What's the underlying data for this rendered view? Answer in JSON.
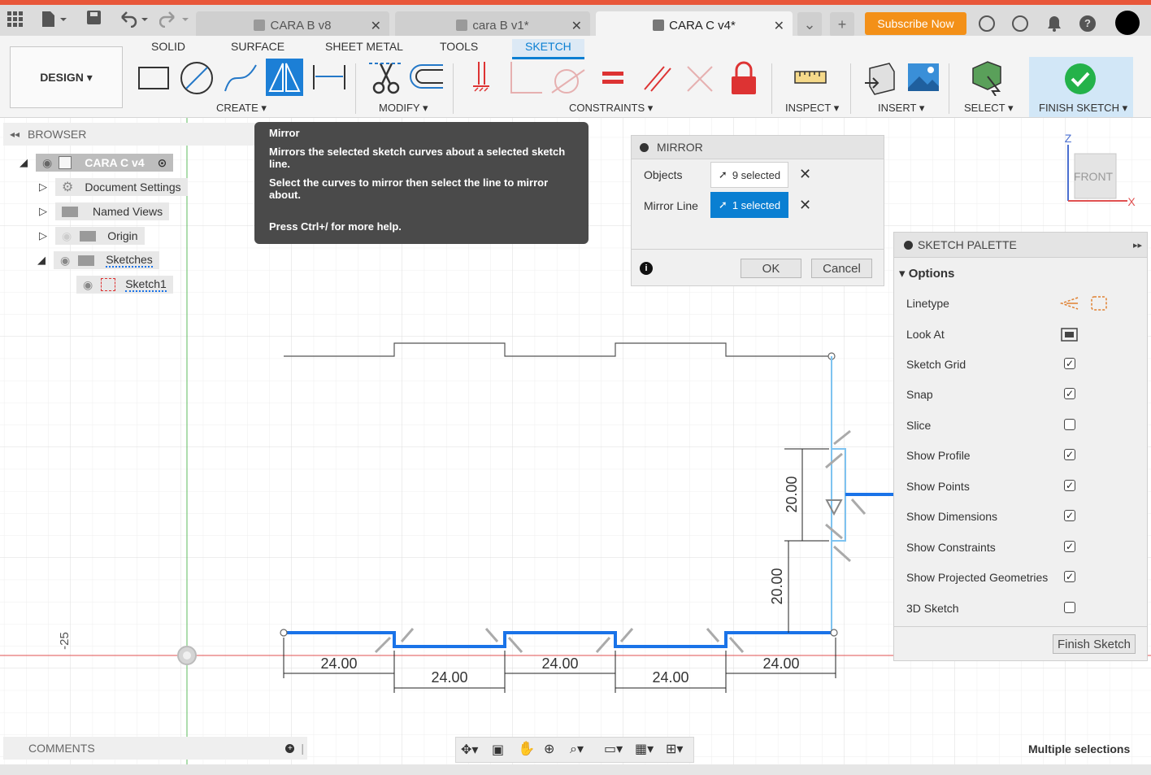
{
  "title_tabs": [
    {
      "label": "CARA B v8"
    },
    {
      "label": "cara B v1*"
    },
    {
      "label": "CARA C v4*"
    }
  ],
  "subscribe_label": "Subscribe Now",
  "ribbon_tabs": [
    "SOLID",
    "SURFACE",
    "SHEET METAL",
    "TOOLS",
    "SKETCH"
  ],
  "workspace": "DESIGN",
  "groups": {
    "create": "CREATE",
    "modify": "MODIFY",
    "constraints": "CONSTRAINTS",
    "inspect": "INSPECT",
    "insert": "INSERT",
    "select": "SELECT",
    "finish": "FINISH SKETCH"
  },
  "browser": {
    "title": "BROWSER",
    "root": "CARA C v4",
    "items": [
      "Document Settings",
      "Named Views",
      "Origin",
      "Sketches",
      "Sketch1"
    ]
  },
  "tooltip": {
    "title": "Mirror",
    "line1": "Mirrors the selected sketch curves about a selected sketch line.",
    "line2": "Select the curves to mirror then select the line to mirror about.",
    "line3": "Press Ctrl+/ for more help."
  },
  "mirror": {
    "title": "MIRROR",
    "objects_label": "Objects",
    "objects_value": "9 selected",
    "mirror_line_label": "Mirror Line",
    "mirror_line_value": "1 selected",
    "ok": "OK",
    "cancel": "Cancel"
  },
  "palette": {
    "title": "SKETCH PALETTE",
    "section": "Options",
    "linetype": "Linetype",
    "look_at": "Look At",
    "options": [
      {
        "label": "Sketch Grid",
        "checked": true
      },
      {
        "label": "Snap",
        "checked": true
      },
      {
        "label": "Slice",
        "checked": false
      },
      {
        "label": "Show Profile",
        "checked": true
      },
      {
        "label": "Show Points",
        "checked": true
      },
      {
        "label": "Show Dimensions",
        "checked": true
      },
      {
        "label": "Show Constraints",
        "checked": true
      },
      {
        "label": "Show Projected Geometries",
        "checked": true
      },
      {
        "label": "3D Sketch",
        "checked": false
      }
    ],
    "finish_button": "Finish Sketch"
  },
  "viewcube": {
    "face": "FRONT",
    "axis_z": "Z",
    "axis_x": "X"
  },
  "dimensions": {
    "bottom_upper": [
      "24.00",
      "24.00",
      "24.00"
    ],
    "bottom_lower": [
      "24.00",
      "24.00"
    ],
    "vertical": [
      "20.00",
      "20.00"
    ],
    "ruler": "-25"
  },
  "comments": "COMMENTS",
  "status": "Multiple selections",
  "colors": {
    "accent": "#0a7fd2",
    "subscribe": "#f39018",
    "selected_line": "#1a73e8"
  }
}
